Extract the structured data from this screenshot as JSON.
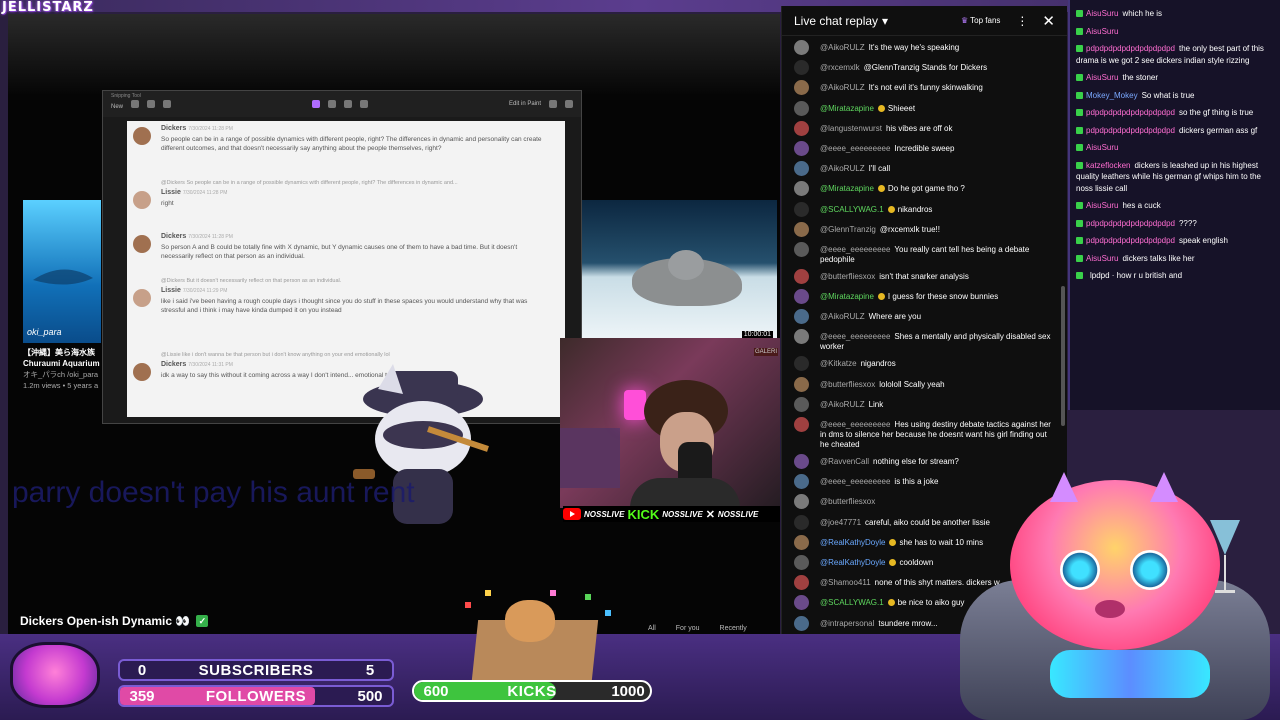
{
  "brand": "JELLISTARZ",
  "snipping": {
    "app_label": "Snipping Tool",
    "new_label": "New",
    "edit_label": "Edit in Paint",
    "messages": [
      {
        "author": "Dickers",
        "time": "7/30/2024 11:28 PM",
        "text": "So people can be in a range of possible dynamics with different people, right? The differences in dynamic and personality can create different outcomes, and that doesn't necessarily say anything about the people themselves, right?"
      },
      {
        "reply": "@Dickers So people can be in a range of possible dynamics with different people, right? The differences in dynamic and...",
        "author": "Lissie",
        "time": "7/30/2024 11:28 PM",
        "text": "right"
      },
      {
        "author": "Dickers",
        "time": "7/30/2024 11:28 PM",
        "text": "So person A and B could be totally fine with X dynamic, but Y dynamic causes one of them to have a bad time. But it doesn't necessarily reflect on that person as an individual."
      },
      {
        "reply": "@Dickers But it doesn't necessarily reflect on that person as an individual.",
        "author": "Lissie",
        "time": "7/30/2024 11:29 PM",
        "text": "like i said i've been having a rough couple days  i thought since you do stuff in these spaces you would understand why that was stressful and i think i may have kinda dumped it on you instead"
      },
      {
        "reply": "@Lissie like i don't wanna be that person but i don't know anything on your end emotionally lol",
        "author": "Dickers",
        "time": "7/30/2024 11:31 PM",
        "text": "idk a way to say this without it coming across a way I don't intend... emotional turbulence over this."
      }
    ]
  },
  "thumb_left": {
    "watermark": "oki_para",
    "title": "【沖縄】美ら海水族 Churaumi Aquarium",
    "channel": "オキ_パラch /oki_para",
    "meta": "1.2m views • 5 years a"
  },
  "thumb_right": {
    "duration": "10:00:01"
  },
  "cam": {
    "sign": "GALERI"
  },
  "socials": {
    "yt": "NOSSLIVE",
    "kick": "KICK",
    "kick_handle": "NOSSLIVE",
    "x": "NOSSLIVE"
  },
  "caption": "parry doesn't pay his aunt rent",
  "video_title": "Dickers Open-ish Dynamic 👀",
  "video_tabs": [
    "All",
    "For you",
    "Recently"
  ],
  "chat": {
    "title": "Live chat replay",
    "top_fans": "Top fans",
    "messages": [
      {
        "author": "@AikoRULZ",
        "text": "It's the way he's speaking",
        "color": ""
      },
      {
        "author": "@rxcemxlk",
        "text": "@GlennTranzig Stands for Dickers",
        "color": ""
      },
      {
        "author": "@AikoRULZ",
        "text": "It's not evil it's funny skinwalking",
        "color": ""
      },
      {
        "author": "@Miratazapine",
        "text": "Shieeet",
        "color": "green",
        "badge": true
      },
      {
        "author": "@langustenwurst",
        "text": "his vibes are off ok",
        "color": ""
      },
      {
        "author": "@eeee_eeeeeeeee",
        "text": "Incredible sweep",
        "color": ""
      },
      {
        "author": "@AikoRULZ",
        "text": "I'll call",
        "color": ""
      },
      {
        "author": "@Miratazapine",
        "text": "Do he got game tho ?",
        "color": "green",
        "badge": true
      },
      {
        "author": "@SCALLYWAG.1",
        "text": "nikandros",
        "color": "green",
        "badge": true
      },
      {
        "author": "@GlennTranzig",
        "text": "@rxcemxlk true!!",
        "color": ""
      },
      {
        "author": "@eeee_eeeeeeeee",
        "text": "You really cant tell hes being a debate pedophile",
        "color": ""
      },
      {
        "author": "@butterfliesxox",
        "text": "isn't that snarker analysis",
        "color": ""
      },
      {
        "author": "@Miratazapine",
        "text": "I guess for these snow bunnies",
        "color": "green",
        "badge": true
      },
      {
        "author": "@AikoRULZ",
        "text": "Where are you",
        "color": ""
      },
      {
        "author": "@eeee_eeeeeeeee",
        "text": "Shes a mentally and physically disabled sex worker",
        "color": ""
      },
      {
        "author": "@Kitkatze",
        "text": "nigandros",
        "color": ""
      },
      {
        "author": "@butterfliesxox",
        "text": "lolololl Scally yeah",
        "color": ""
      },
      {
        "author": "@AikoRULZ",
        "text": "Link",
        "color": ""
      },
      {
        "author": "@eeee_eeeeeeeee",
        "text": "Hes using destiny debate tactics against her in dms to silence her because he doesnt want his girl finding out he cheated",
        "color": ""
      },
      {
        "author": "@RavvenCall",
        "text": "nothing else for stream?",
        "color": ""
      },
      {
        "author": "@eeee_eeeeeeeee",
        "text": "is this a joke",
        "color": ""
      },
      {
        "author": "@butterfliesxox",
        "text": "",
        "color": ""
      },
      {
        "author": "@joe47771",
        "text": "careful, aiko could be another lissie",
        "color": ""
      },
      {
        "author": "@RealKathyDoyle",
        "text": "she has to wait 10 mins",
        "color": "blue",
        "badge": true
      },
      {
        "author": "@RealKathyDoyle",
        "text": "cooldown",
        "color": "blue",
        "badge": true
      },
      {
        "author": "@Shamoo411",
        "text": "none of this shyt matters. dickers w",
        "color": ""
      },
      {
        "author": "@SCALLYWAG.1",
        "text": "be nice to aiko guy",
        "color": "green",
        "badge": true
      },
      {
        "author": "@intrapersonal",
        "text": "tsundere mrow...",
        "color": ""
      }
    ]
  },
  "alt_chat": [
    {
      "user": "AisuSuru",
      "text": "which he is",
      "ucolor": "pink"
    },
    {
      "user": "AisuSuru",
      "text": "",
      "ucolor": "pink"
    },
    {
      "user": "pdpdpdpdpdpdpdpdpdpd",
      "text": "the only best part of this drama is we got 2 see dickers indian style rizzing",
      "ucolor": "pink"
    },
    {
      "user": "AisuSuru",
      "text": "the stoner",
      "ucolor": "pink"
    },
    {
      "user": "Mokey_Mokey",
      "text": "So what is true",
      "ucolor": "blue"
    },
    {
      "user": "pdpdpdpdpdpdpdpdpdpd",
      "text": "so the gf thing is true",
      "ucolor": "pink"
    },
    {
      "user": "pdpdpdpdpdpdpdpdpdpd",
      "text": "dickers german ass gf",
      "ucolor": "pink"
    },
    {
      "user": "AisuSuru",
      "text": "",
      "ucolor": "pink"
    },
    {
      "user": "katzeflocken",
      "text": "dickers is leashed up in his highest quality leathers while his german gf whips him to the noss lissie call",
      "ucolor": "pink"
    },
    {
      "user": "AisuSuru",
      "text": "hes a cuck",
      "ucolor": "pink"
    },
    {
      "user": "pdpdpdpdpdpdpdpdpdpd",
      "text": "????",
      "ucolor": "pink"
    },
    {
      "user": "pdpdpdpdpdpdpdpdpdpd",
      "text": "speak english",
      "ucolor": "pink"
    },
    {
      "user": "AisuSuru",
      "text": "dickers talks like her",
      "ucolor": "pink"
    },
    {
      "user": "",
      "text": "lpdpd · how r u british and",
      "ucolor": "pink"
    }
  ],
  "stats": {
    "subscribers_label": "SUBSCRIBERS",
    "subscribers_current": "0",
    "subscribers_goal": "5",
    "followers_label": "FOLLOWERS",
    "followers_current": "359",
    "followers_goal": "500",
    "followers_progress": 0.718,
    "kicks_label": "KICKS",
    "kicks_current": "600",
    "kicks_goal": "1000",
    "kicks_progress": 0.6
  }
}
